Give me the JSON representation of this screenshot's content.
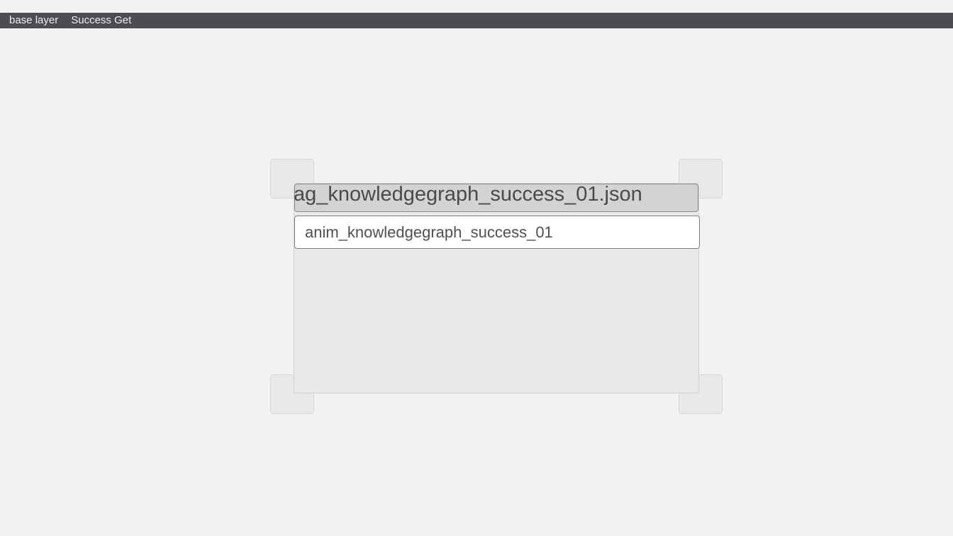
{
  "breadcrumb": {
    "items": [
      {
        "label": "base layer"
      },
      {
        "label": "Success Get"
      }
    ]
  },
  "panel": {
    "file_title": "ag_knowledgegraph_success_01.json",
    "animation_name": "anim_knowledgegraph_success_01"
  }
}
